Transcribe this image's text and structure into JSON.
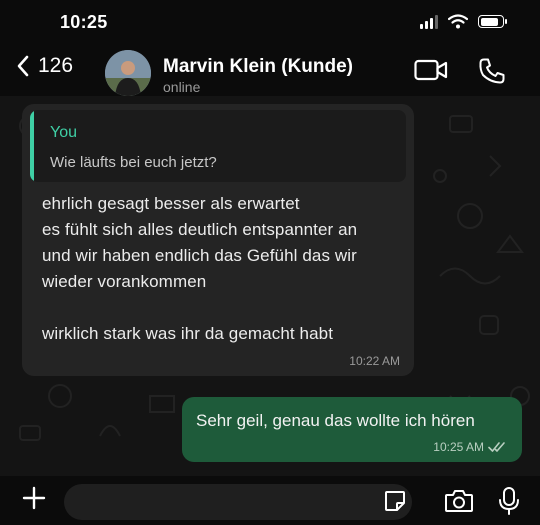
{
  "status_bar": {
    "time": "10:25",
    "battery_level": 0.85
  },
  "header": {
    "back_count": "126",
    "contact_name": "Marvin Klein (Kunde)",
    "contact_status": "online"
  },
  "messages": [
    {
      "direction": "incoming",
      "quote": {
        "author": "You",
        "text": "Wie läufts bei euch jetzt?"
      },
      "lines": [
        "ehrlich gesagt besser als erwartet",
        "es fühlt sich alles deutlich entspannter an",
        "und wir haben endlich das Gefühl das wir",
        "wieder vorankommen",
        "",
        "wirklich stark was ihr da gemacht habt"
      ],
      "time": "10:22 AM"
    },
    {
      "direction": "outgoing",
      "text": "Sehr geil, genau das wollte ich hören",
      "time": "10:25 AM",
      "status": "read"
    }
  ],
  "input": {
    "value": "",
    "placeholder": ""
  },
  "icons": {
    "back": "chevron-left-icon",
    "video": "video-camera-icon",
    "call": "phone-icon",
    "attach": "plus-icon",
    "sticker": "sticker-icon",
    "camera": "camera-icon",
    "mic": "microphone-icon",
    "read_receipt": "double-check-icon"
  },
  "colors": {
    "accent": "#3fcfa5",
    "outgoing_bubble": "#1e5b3a",
    "incoming_bubble": "#242424",
    "background": "#0b0b0b"
  }
}
